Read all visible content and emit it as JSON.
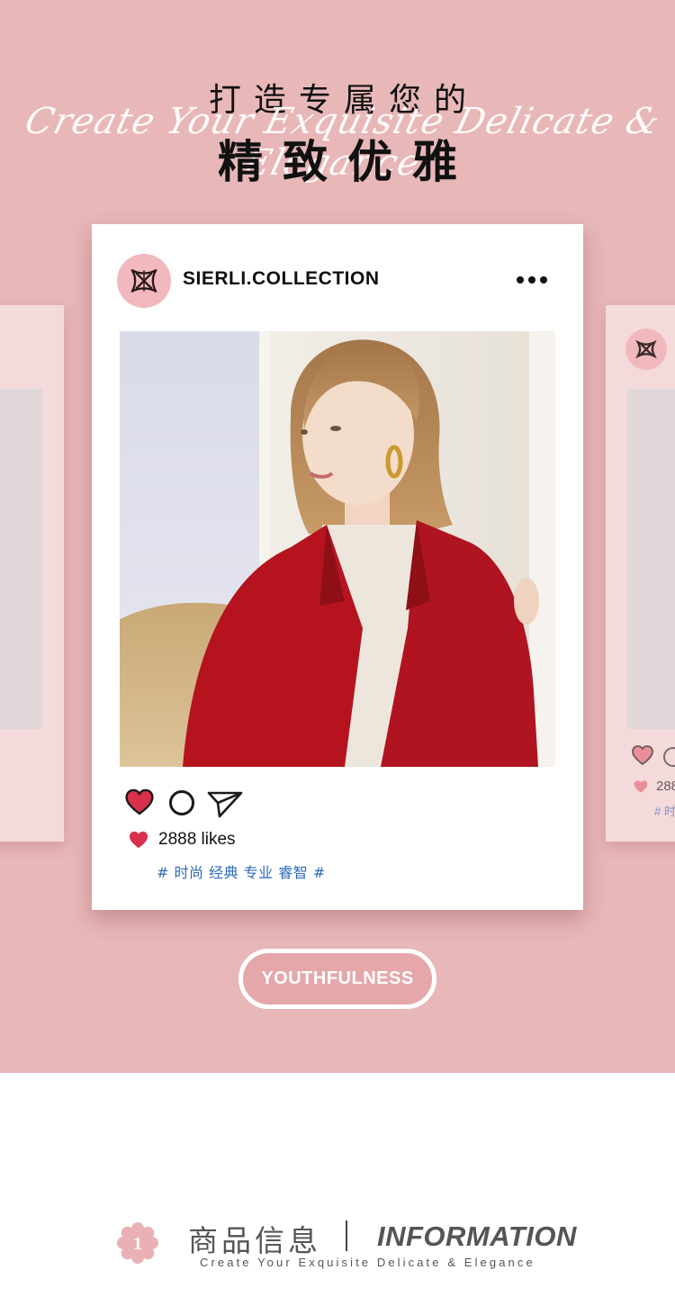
{
  "header": {
    "line1": "打造专属您的",
    "script": "Create Your Exquisite Delicate & Elegance",
    "line2": "精致优雅"
  },
  "post": {
    "username": "SIERLI.COLLECTION",
    "more_icon": "more-dots-icon",
    "photo": "woman-in-red-coat",
    "likes": "2888 likes",
    "tags": "# 时尚 经典 专业 睿智 #"
  },
  "side_card_right": {
    "likes": "288",
    "tags": "# 时"
  },
  "badge": {
    "label": "YOUTHFULNESS"
  },
  "info": {
    "number": "1",
    "title_cn": "商品信息",
    "title_en": "INFORMATION",
    "subtitle": "Create Your Exquisite Delicate & Elegance"
  },
  "colors": {
    "background_pink": "#e8b7b8",
    "heart_red": "#d9314b",
    "tag_blue": "#2e6bb8",
    "badge_pink": "#e5a7aa"
  }
}
